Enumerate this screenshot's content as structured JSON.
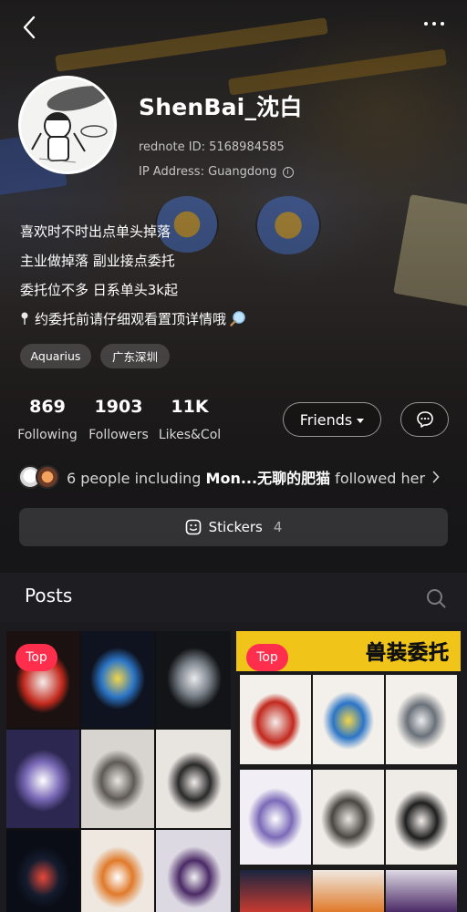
{
  "profile": {
    "username": "ShenBai_沈白",
    "rednote_id": "rednote ID: 5168984585",
    "ip_address": "IP Address: Guangdong",
    "bio": [
      "喜欢时不时出点单头掉落",
      "主业做掉落 副业接点委托",
      "委托位不多 日系单头3k起",
      "约委托前请仔细观看置顶详情哦"
    ],
    "tags": [
      "Aquarius",
      "广东深圳"
    ]
  },
  "stats": [
    {
      "value": "869",
      "label": "Following"
    },
    {
      "value": "1903",
      "label": "Followers"
    },
    {
      "value": "11K",
      "label": "Likes&Col"
    }
  ],
  "actions": {
    "friends_label": "Friends"
  },
  "followed": {
    "prefix": "6 people including ",
    "name": "Mon...无聊的肥猫",
    "suffix": " followed her"
  },
  "stickers": {
    "label": "Stickers",
    "count": "4"
  },
  "posts": {
    "title": "Posts",
    "items": [
      {
        "badge": "Top"
      },
      {
        "badge": "Top",
        "banner": "兽装委托"
      }
    ]
  },
  "colors": {
    "accent_red": "#ff2e4d",
    "banner_yellow": "#f0c419",
    "section_bg": "#1e1e22"
  },
  "icons": [
    "back-arrow-icon",
    "more-dots-icon",
    "info-icon",
    "pin-icon",
    "magnifier-icon",
    "chat-bubble-icon",
    "chevron-right-icon",
    "sticker-face-icon",
    "search-icon"
  ]
}
